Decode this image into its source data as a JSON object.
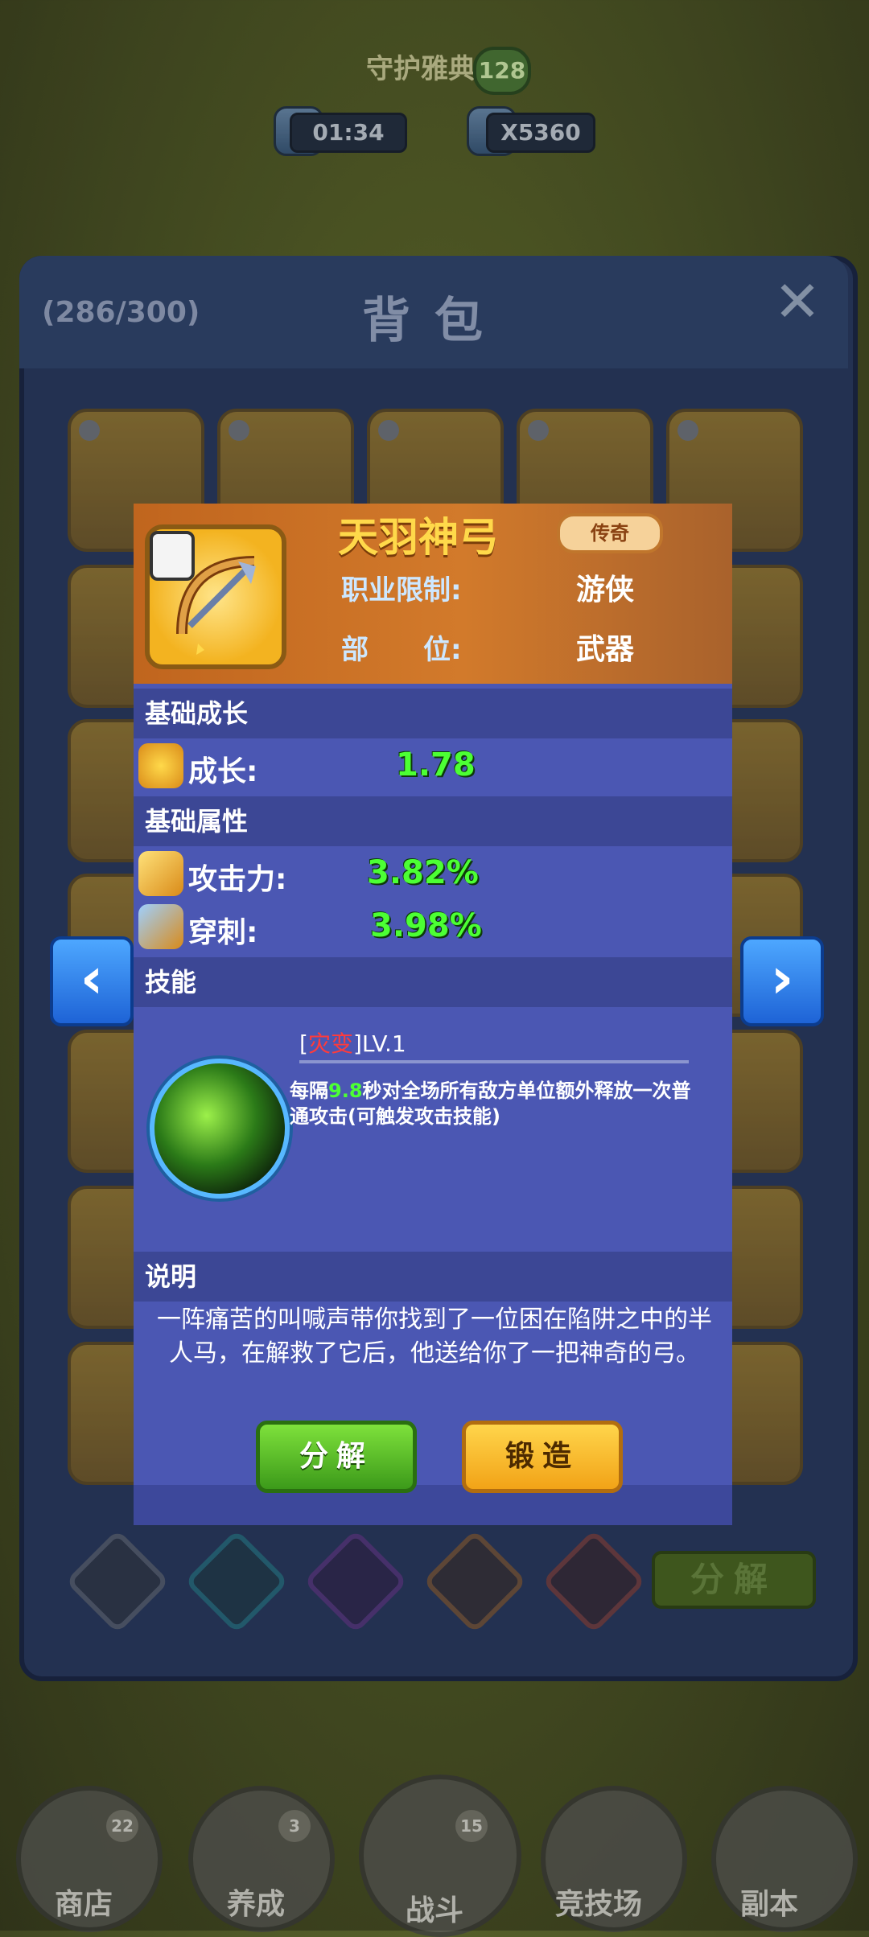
{
  "hud": {
    "title": "守护雅典娜",
    "level": "128",
    "timer": "01:34",
    "coins": "X5360"
  },
  "bag": {
    "count": "(286/300)",
    "title": "背包",
    "close": "✕",
    "decompose": "分解"
  },
  "item": {
    "name": "天羽神弓",
    "rarity": "传奇",
    "class_label": "职业限制:",
    "class_value": "游侠",
    "slot_label": "部　　位:",
    "slot_value": "武器"
  },
  "sections": {
    "growth": "基础成长",
    "attributes": "基础属性",
    "skill": "技能",
    "description": "说明"
  },
  "stats": {
    "growth_label": "成长:",
    "growth_value": "1.78",
    "attack_label": "攻击力:",
    "attack_value": "3.82%",
    "pierce_label": "穿刺:",
    "pierce_value": "3.98%"
  },
  "skill": {
    "bracket_open": "[",
    "name": "灾变",
    "bracket_close": "]",
    "level": "LV.1",
    "desc_prefix": "每隔",
    "desc_number": "9.8",
    "desc_suffix": "秒对全场所有敌方单位额外释放一次普通攻击(可触发攻击技能)"
  },
  "flavor_text": "一阵痛苦的叫喊声带你找到了一位困在陷阱之中的半人马，在解救了它后，他送给你了一把神奇的弓。",
  "buttons": {
    "decompose": "分解",
    "forge": "锻造"
  },
  "nav": [
    {
      "label": "商店",
      "badge": "22"
    },
    {
      "label": "养成",
      "badge": "3"
    },
    {
      "label": "战斗",
      "badge": "15"
    },
    {
      "label": "竞技场",
      "badge": ""
    },
    {
      "label": "副本",
      "badge": ""
    }
  ],
  "arrows": {
    "left": "‹",
    "right": "›"
  },
  "colors": {
    "header_orange": "#c0651e",
    "panel_blue": "#4b57b3",
    "stat_green": "#4cff34",
    "skill_name_red": "#ff3b3b"
  }
}
